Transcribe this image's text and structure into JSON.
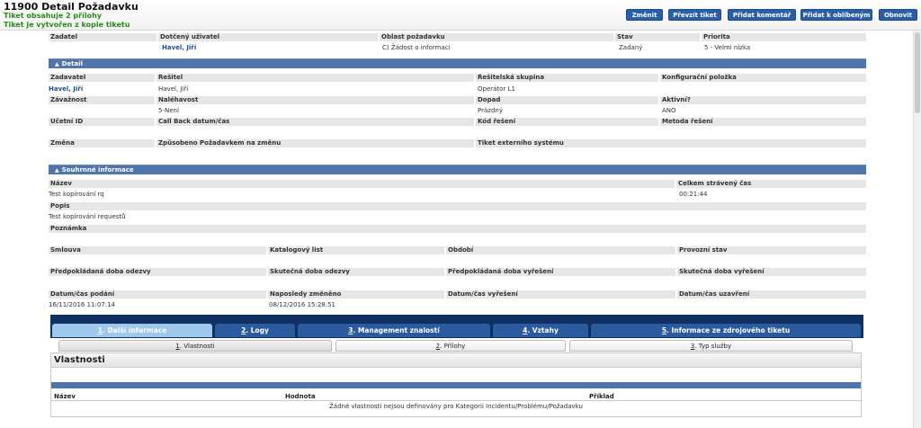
{
  "header": {
    "title": "11900 Detail Požadavku",
    "note1": "Tiket obsahuje 2 přílohy",
    "note2": "Tiket je vytvořen z kopie tiketu",
    "buttons": [
      "Změnit",
      "Převzít tiket",
      "Přidat komentář",
      "Přidat k oblíbeným",
      "Obnovit"
    ]
  },
  "top": {
    "labels": [
      "Žadatel",
      "Dotčený uživatel",
      "Oblast požadavku",
      "Stav",
      "Priorita"
    ],
    "values": [
      "",
      "Havel, Jiří",
      "C) Žádost o informaci",
      "Zadaný",
      "5 - Velmi nízka"
    ]
  },
  "detail": {
    "section": "Detail",
    "row1_labels": [
      "Zadavatel",
      "Řešitel",
      "Řešitelská skupina",
      "Konfigurační položka"
    ],
    "row1_values": [
      "Havel, Jiří",
      "Havel, Jiří",
      "Operátor L1",
      ""
    ],
    "row2_labels": [
      "Závažnost",
      "Naléhavost",
      "Dopad",
      "Aktivní?"
    ],
    "row2_values": [
      "",
      "5-Není",
      "Prázdný",
      "ANO"
    ],
    "row3_labels": [
      "Účetní ID",
      "Call Back datum/čas",
      "Kód řešení",
      "Metoda řešení"
    ],
    "row4_labels": [
      "Změna",
      "Způsobeno Požadavkem na změnu",
      "Tiket externího systému"
    ]
  },
  "summary": {
    "section": "Souhrnné informace",
    "name_label": "Název",
    "name_value": "Test kopírování rq",
    "time_label": "Celkem strávený čas",
    "time_value": "00:21:44",
    "desc_label": "Popis",
    "desc_value": "Test kopírování requestů",
    "note_label": "Poznámka",
    "rowA_labels": [
      "Smlouva",
      "Katalogový list",
      "Období",
      "Provozní stav"
    ],
    "rowB_labels": [
      "Předpokládaná doba odezvy",
      "Skutečná doba odezvy",
      "Předpokládaná doba vyřešení",
      "Skutečná doba vyřešení"
    ],
    "rowC_labels": [
      "Datum/čas podání",
      "Naposledy změněno",
      "Datum/čas vyřešení",
      "Datum/čas uzavření"
    ],
    "rowC_values": [
      "16/11/2016 11:07:14",
      "08/12/2016 15:28:51",
      "",
      ""
    ]
  },
  "tabs": [
    {
      "num": "1",
      "label": ". Další informace"
    },
    {
      "num": "2",
      "label": ". Logy"
    },
    {
      "num": "3",
      "label": ". Management znalostí"
    },
    {
      "num": "4",
      "label": ". Vztahy"
    },
    {
      "num": "5",
      "label": ". Informace ze zdrojového tiketu"
    }
  ],
  "subtabs": [
    {
      "num": "1",
      "label": ". Vlastnosti"
    },
    {
      "num": "2",
      "label": ". Přílohy"
    },
    {
      "num": "3",
      "label": ". Typ služby"
    }
  ],
  "panel": {
    "title": "Vlastnosti",
    "columns": [
      "Název",
      "Hodnota",
      "Příklad"
    ],
    "empty_text": "Žádné vlastnosti nejsou definovány pro Kategorii Incidentu/Problému/Požadavku"
  },
  "colors": {
    "accent": "#2a5fa8",
    "section_bar": "#4f75aa",
    "tab_bg": "#0f2f63",
    "green_note": "#2a8a1a"
  }
}
